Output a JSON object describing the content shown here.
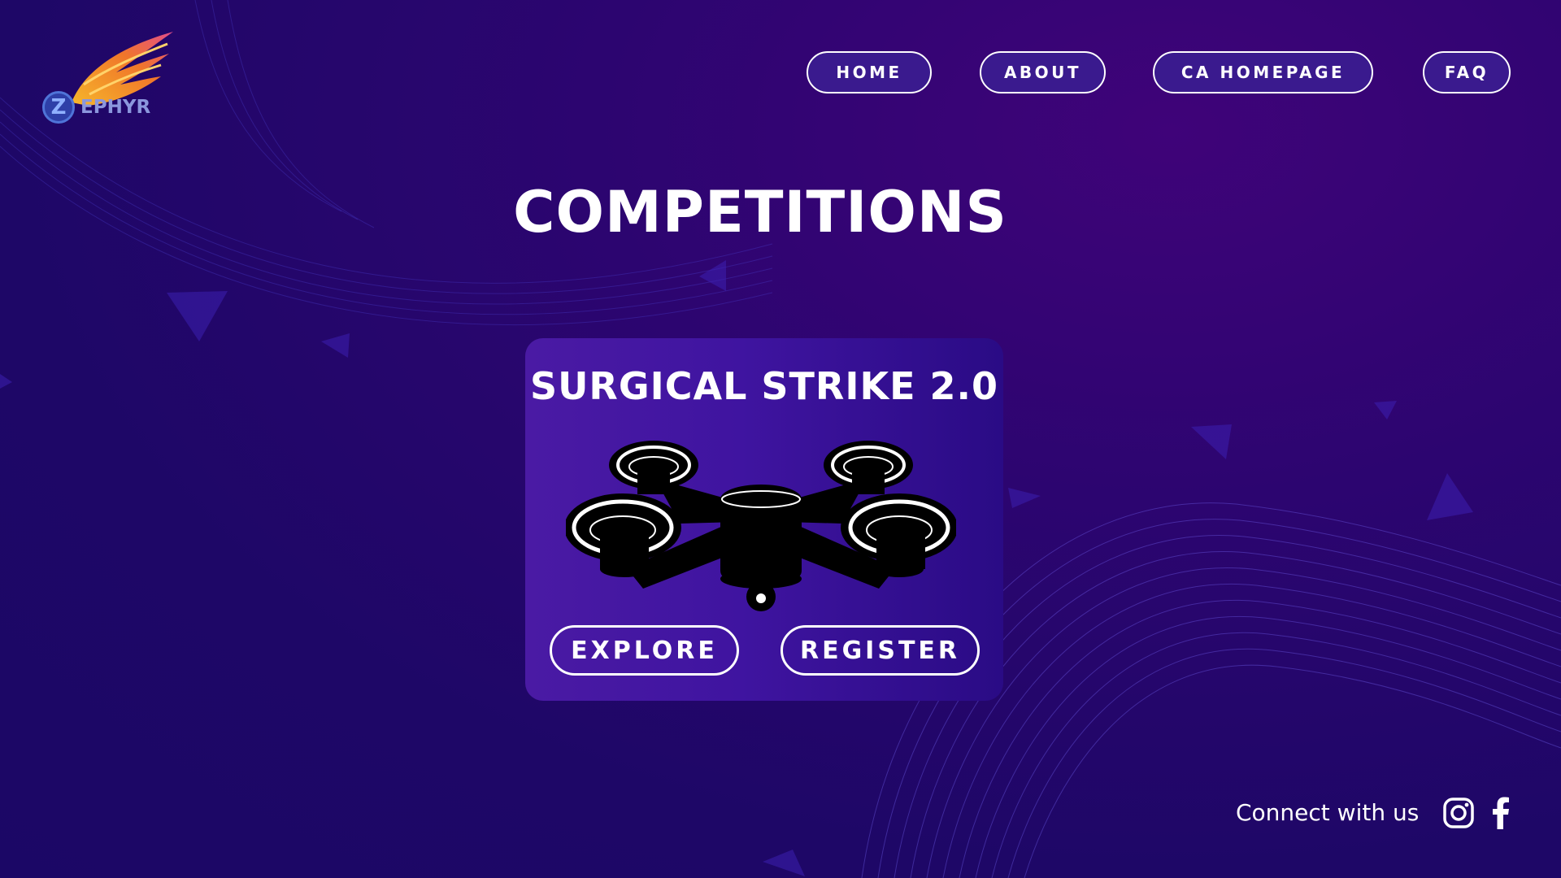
{
  "brand": {
    "logo_letter": "Z",
    "logo_rest": "EPHYR"
  },
  "nav": {
    "items": [
      {
        "label": "HOME"
      },
      {
        "label": "ABOUT"
      },
      {
        "label": "CA HOMEPAGE"
      },
      {
        "label": "FAQ"
      }
    ]
  },
  "page": {
    "title": "COMPETITIONS"
  },
  "competition_card": {
    "title": "SURGICAL STRIKE 2.0",
    "image_icon": "drone-icon",
    "explore_label": "EXPLORE",
    "register_label": "REGISTER"
  },
  "footer": {
    "connect_label": "Connect with us",
    "social_icons": [
      "instagram-icon",
      "facebook-icon"
    ]
  },
  "colors": {
    "background": "#1e0767",
    "nav_button_fill": "#3a1a8e",
    "card_gradient_start": "#4a1aa4",
    "card_gradient_end": "#2a0b85",
    "logo_wing_orange": "#f39a2a",
    "logo_wing_pink": "#e24d8a"
  }
}
